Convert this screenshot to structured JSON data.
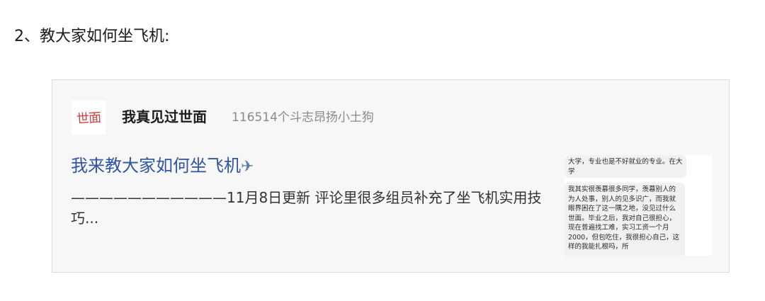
{
  "section": {
    "heading": "2、教大家如何坐飞机:"
  },
  "card": {
    "avatar_text": "世面",
    "group_name": "我真见过世面",
    "group_meta": "116514个斗志昂扬小土狗",
    "post_title": "我来教大家如何坐飞机",
    "post_title_emoji": "✈",
    "excerpt": "———————————11月8日更新 评论里很多组员补充了坐飞机实用技巧...",
    "thumbnail": {
      "bubble1": "大学，专业也是不好就业的专业。在大学",
      "bubble2": "我其实很羡慕很多同学，羡慕别人的为人处事，别人的见多识广，而我就眼界困在了这一隅之地，没见过什么世面。毕业之后，我对自己很担心，现在普遍找工难，实习工资一个月2000，但包吃住，我很担心自己，这样的我能扎根吗，所"
    }
  }
}
